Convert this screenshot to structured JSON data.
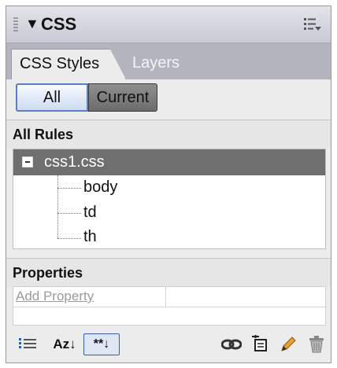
{
  "panel": {
    "title": "CSS",
    "collapse_arrow": "▼",
    "tabs": [
      "CSS Styles",
      "Layers"
    ],
    "mode_buttons": [
      "All",
      "Current"
    ],
    "selected_mode": "All"
  },
  "rules": {
    "header": "All Rules",
    "file": "css1.css",
    "items": [
      "body",
      "td",
      "th"
    ]
  },
  "properties": {
    "header": "Properties",
    "add_property": "Add Property"
  },
  "toolbar": {
    "icons": [
      "category-view-icon",
      "alphabetical-view-icon",
      "set-properties-view-icon",
      "attach-style-sheet-icon",
      "new-css-rule-icon",
      "edit-style-icon",
      "delete-icon"
    ],
    "sort_label": "Az↓",
    "set_props_label": "**↓"
  },
  "colors": {
    "accent": "#5a7ec2",
    "selected_row": "#6f6f6f",
    "tab_strip": "#b3b4be"
  }
}
